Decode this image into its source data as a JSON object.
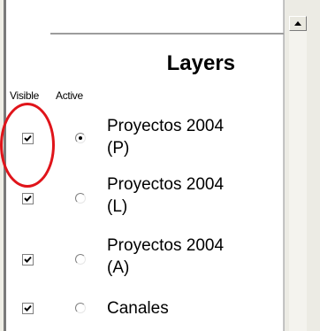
{
  "panel": {
    "title": "Layers",
    "column_visible": "Visible",
    "column_active": "Active"
  },
  "layers": [
    {
      "label_line1": "Proyectos 2004",
      "label_line2": "(P)",
      "visible": true,
      "active": true
    },
    {
      "label_line1": "Proyectos 2004",
      "label_line2": "(L)",
      "visible": true,
      "active": false
    },
    {
      "label_line1": "Proyectos 2004",
      "label_line2": "(A)",
      "visible": true,
      "active": false
    },
    {
      "label_line1": "Canales",
      "label_line2": "",
      "visible": true,
      "active": false
    }
  ],
  "annotation": {
    "color": "#e0141a"
  },
  "icons": {
    "scroll_up": "scroll-up-arrow-icon",
    "checkmark": "checkmark-icon",
    "radio_dot": "radio-dot-icon"
  }
}
